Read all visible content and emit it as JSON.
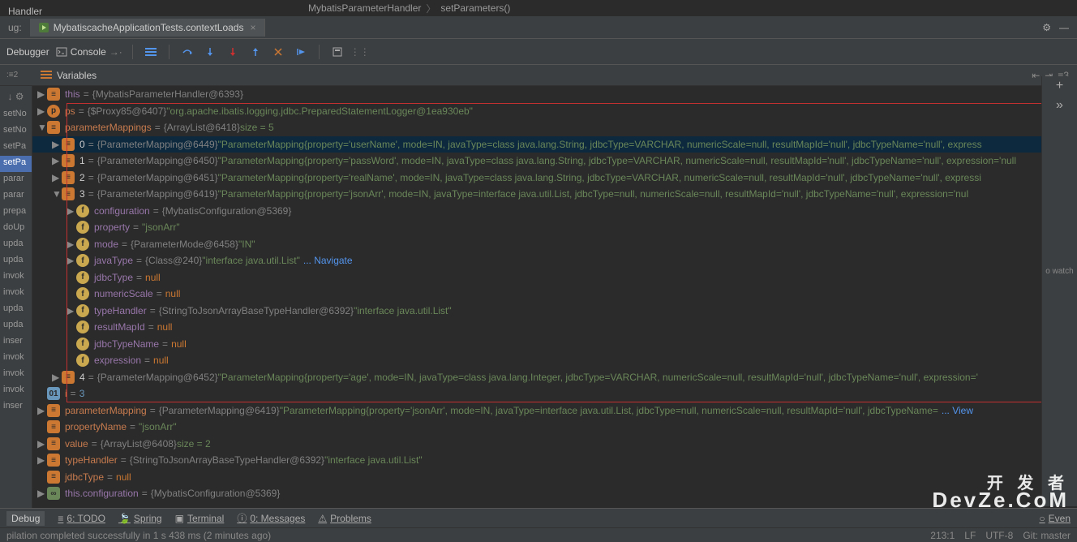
{
  "breadcrumb": {
    "left": "Handler",
    "main": "MybatisParameterHandler",
    "sub": "setParameters()"
  },
  "tabbar": {
    "prefix": "ug:",
    "tab_label": "MybatiscacheApplicationTests.contextLoads",
    "close_x": "×"
  },
  "toolbar": {
    "debugger": "Debugger",
    "console": "Console"
  },
  "var_header": {
    "label": "Variables"
  },
  "frames_header": {
    "label": ":≡2",
    "right_badge": "≡3",
    "filter_icons": "↑↓ ⚙"
  },
  "frames": [
    "setNo",
    "setNo",
    "setPa",
    "setPa",
    "parar",
    "parar",
    "prepa",
    "doUp",
    "upda",
    "upda",
    "invok",
    "invok",
    "upda",
    "upda",
    "inser",
    "invok",
    "invok",
    "invok",
    "inser"
  ],
  "frames_selected_index": 3,
  "right_top_text": "o watch",
  "tree": [
    {
      "indent": 0,
      "arrow": "▶",
      "badge": "obj",
      "name": "this",
      "cls": "purple",
      "val_ref": "{MybatisParameterHandler@6393}",
      "val_str": ""
    },
    {
      "indent": 0,
      "arrow": "▶",
      "badge": "p",
      "name": "ps",
      "cls": "varname",
      "val_ref": "{$Proxy85@6407}",
      "val_str": "\"org.apache.ibatis.logging.jdbc.PreparedStatementLogger@1ea930eb\""
    },
    {
      "indent": 0,
      "arrow": "▼",
      "badge": "obj",
      "name": "parameterMappings",
      "cls": "varname",
      "val_ref": "{ArrayList@6418}",
      "val_str": " size = 5"
    },
    {
      "indent": 1,
      "arrow": "▶",
      "badge": "obj",
      "name": "0",
      "cls": "white",
      "val_ref": "{ParameterMapping@6449}",
      "val_str": "\"ParameterMapping{property='userName', mode=IN, javaType=class java.lang.String, jdbcType=VARCHAR, numericScale=null, resultMapId='null', jdbcTypeName='null', express",
      "selected": true
    },
    {
      "indent": 1,
      "arrow": "▶",
      "badge": "obj",
      "name": "1",
      "cls": "white",
      "val_ref": "{ParameterMapping@6450}",
      "val_str": "\"ParameterMapping{property='passWord', mode=IN, javaType=class java.lang.String, jdbcType=VARCHAR, numericScale=null, resultMapId='null', jdbcTypeName='null', expression='null"
    },
    {
      "indent": 1,
      "arrow": "▶",
      "badge": "obj",
      "name": "2",
      "cls": "white",
      "val_ref": "{ParameterMapping@6451}",
      "val_str": "\"ParameterMapping{property='realName', mode=IN, javaType=class java.lang.String, jdbcType=VARCHAR, numericScale=null, resultMapId='null', jdbcTypeName='null', expressi"
    },
    {
      "indent": 1,
      "arrow": "▼",
      "badge": "obj",
      "name": "3",
      "cls": "white",
      "val_ref": "{ParameterMapping@6419}",
      "val_str": "\"ParameterMapping{property='jsonArr', mode=IN, javaType=interface java.util.List, jdbcType=null, numericScale=null, resultMapId='null', jdbcTypeName='null', expression='nul"
    },
    {
      "indent": 2,
      "arrow": "▶",
      "badge": "f",
      "name": "configuration",
      "cls": "purple",
      "val_ref": "{MybatisConfiguration@5369}",
      "val_str": ""
    },
    {
      "indent": 2,
      "arrow": "",
      "badge": "f",
      "name": "property",
      "cls": "purple",
      "val_ref": "",
      "val_str": "\"jsonArr\""
    },
    {
      "indent": 2,
      "arrow": "▶",
      "badge": "f",
      "name": "mode",
      "cls": "purple",
      "val_ref": "{ParameterMode@6458}",
      "val_str": "\"IN\""
    },
    {
      "indent": 2,
      "arrow": "▶",
      "badge": "f",
      "name": "javaType",
      "cls": "purple",
      "val_ref": "{Class@240}",
      "val_str": "\"interface java.util.List\"",
      "trail": " ... Navigate"
    },
    {
      "indent": 2,
      "arrow": "",
      "badge": "f",
      "name": "jdbcType",
      "cls": "purple",
      "val_ref": "",
      "val_str": "",
      "null": true
    },
    {
      "indent": 2,
      "arrow": "",
      "badge": "f",
      "name": "numericScale",
      "cls": "purple",
      "val_ref": "",
      "val_str": "",
      "null": true
    },
    {
      "indent": 2,
      "arrow": "▶",
      "badge": "f",
      "name": "typeHandler",
      "cls": "purple",
      "val_ref": "{StringToJsonArrayBaseTypeHandler@6392}",
      "val_str": "\"interface java.util.List\""
    },
    {
      "indent": 2,
      "arrow": "",
      "badge": "f",
      "name": "resultMapId",
      "cls": "purple",
      "val_ref": "",
      "val_str": "",
      "null": true
    },
    {
      "indent": 2,
      "arrow": "",
      "badge": "f",
      "name": "jdbcTypeName",
      "cls": "purple",
      "val_ref": "",
      "val_str": "",
      "null": true
    },
    {
      "indent": 2,
      "arrow": "",
      "badge": "f",
      "name": "expression",
      "cls": "purple",
      "val_ref": "",
      "val_str": "",
      "null": true
    },
    {
      "indent": 1,
      "arrow": "▶",
      "badge": "obj",
      "name": "4",
      "cls": "white",
      "val_ref": "{ParameterMapping@6452}",
      "val_str": "\"ParameterMapping{property='age', mode=IN, javaType=class java.lang.Integer, jdbcType=VARCHAR, numericScale=null, resultMapId='null', jdbcTypeName='null', expression='"
    },
    {
      "indent": 0,
      "arrow": "",
      "badge": "stat",
      "name": "i",
      "cls": "varname",
      "val_ref": "",
      "val_str": "3",
      "plainnum": true
    },
    {
      "indent": 0,
      "arrow": "▶",
      "badge": "obj",
      "name": "parameterMapping",
      "cls": "varname",
      "val_ref": "{ParameterMapping@6419}",
      "val_str": "\"ParameterMapping{property='jsonArr', mode=IN, javaType=interface java.util.List, jdbcType=null, numericScale=null, resultMapId='null', jdbcTypeName=",
      "trail": " ... View"
    },
    {
      "indent": 0,
      "arrow": "",
      "badge": "obj",
      "name": "propertyName",
      "cls": "varname",
      "val_ref": "",
      "val_str": "\"jsonArr\""
    },
    {
      "indent": 0,
      "arrow": "▶",
      "badge": "obj",
      "name": "value",
      "cls": "varname",
      "val_ref": "{ArrayList@6408}",
      "val_str": " size = 2"
    },
    {
      "indent": 0,
      "arrow": "▶",
      "badge": "obj",
      "name": "typeHandler",
      "cls": "varname",
      "val_ref": "{StringToJsonArrayBaseTypeHandler@6392}",
      "val_str": "\"interface java.util.List\""
    },
    {
      "indent": 0,
      "arrow": "",
      "badge": "obj",
      "name": "jdbcType",
      "cls": "varname",
      "val_ref": "",
      "val_str": "",
      "null": true
    },
    {
      "indent": 0,
      "arrow": "▶",
      "badge": "infin",
      "name": "this.configuration",
      "cls": "purple",
      "val_ref": "{MybatisConfiguration@5369}",
      "val_str": ""
    }
  ],
  "bottom": {
    "debug": "Debug",
    "todo": "6: TODO",
    "spring": "Spring",
    "terminal": "Terminal",
    "messages": "0: Messages",
    "problems": "Problems",
    "event": "Even"
  },
  "status": {
    "msg": "pilation completed successfully in 1 s 438 ms (2 minutes ago)",
    "pos": "213:1",
    "enc": "LF",
    "enc2": "UTF-8",
    "git": "Git: master"
  },
  "watermark": {
    "line1": "开 发 者",
    "line2": "DevZe.CoM"
  }
}
